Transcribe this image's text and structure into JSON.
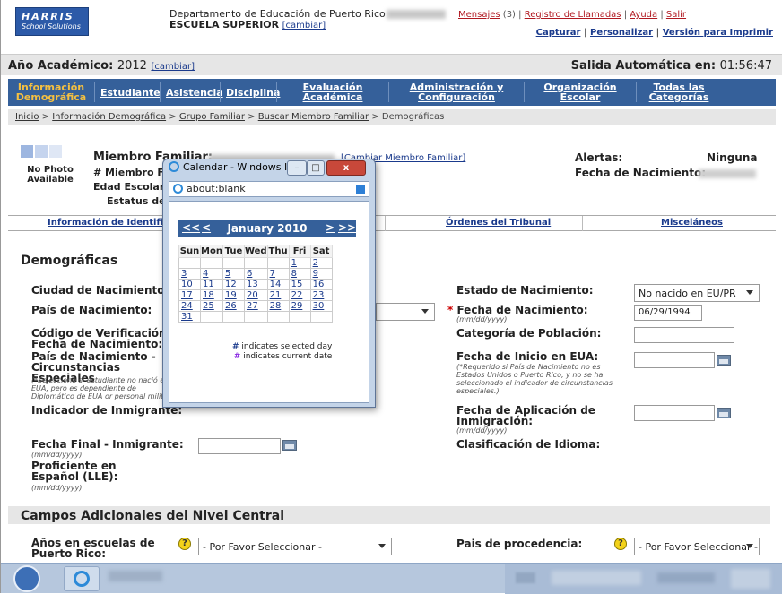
{
  "header": {
    "logo_line1": "HARRIS",
    "logo_line2": "School Solutions",
    "department": "Departamento de Educación de Puerto Rico",
    "school": "ESCUELA SUPERIOR",
    "school_change": "[cambiar]",
    "messages_label": "Mensajes",
    "messages_count": "(3)",
    "call_log": "Registro de Llamadas",
    "help": "Ayuda",
    "logout": "Salir",
    "capture": "Capturar",
    "customize": "Personalizar",
    "print_version": "Versión para Imprimir"
  },
  "yearbar": {
    "year_label": "Año Académico:",
    "year_value": "2012",
    "year_change": "[cambiar]",
    "auto_label": "Salida Automática en:",
    "auto_value": "01:56:47"
  },
  "nav": {
    "items": [
      {
        "label": "Información\nDemográfica"
      },
      {
        "label": "Estudiante"
      },
      {
        "label": "Asistencia"
      },
      {
        "label": "Disciplina"
      },
      {
        "label": "Evaluación\nAcadémica"
      },
      {
        "label": "Administración y\nConfiguración"
      },
      {
        "label": "Organización\nEscolar"
      },
      {
        "label": "Todas las\nCategorías"
      }
    ]
  },
  "breadcrumb": {
    "home": "Inicio",
    "demo": "Información Demográfica",
    "family": "Grupo Familiar",
    "search": "Buscar Miembro Familiar",
    "current": "Demográficas"
  },
  "member": {
    "photo_text": "No Photo Available",
    "family_member": "Miembro Familiar:",
    "member_number": "# Miembro Fa",
    "school_age": "Edad Escolar:",
    "status": "Estatus de Ma",
    "change_member": "[Cambiar Miembro Familiar]",
    "alerts_label": "Alertas:",
    "alerts_value": "Ninguna",
    "birth_label": "Fecha de Nacimiento:"
  },
  "tabs": {
    "identification": "Información de Identificac",
    "court_orders": "Órdenes del Tribunal",
    "misc": "Misceláneos"
  },
  "form": {
    "section_title": "Demográficas",
    "birth_city": "Ciudad de Nacimiento:",
    "birth_country": "País de Nacimiento:",
    "verification_code": "Código de Verificación de Fecha de Nacimiento:",
    "country_special": "País de Nacimiento - Circunstancias Especiales",
    "country_special_hint": "(*Seleccione si estudiante no nació e EUA, pero es dependiente de Diplomático de EUA or personal milit",
    "immigrant_indicator": "Indicador de Inmigrante:",
    "immigrant_end": "Fecha Final - Inmigrante:",
    "immigrant_end_hint": "(mm/dd/yyyy)",
    "spanish_proficient": "Proficiente en Español (LLE):",
    "spanish_hint": "(mm/dd/yyyy)",
    "birth_state": "Estado de Nacimiento:",
    "birth_state_value": "No nacido en EU/PR",
    "birth_date_req": "*",
    "birth_date": "Fecha de Nacimiento:",
    "birth_date_hint": "(mm/dd/yyyy)",
    "birth_date_value": "06/29/1994",
    "population_cat": "Categoría de Población:",
    "us_start": "Fecha de Inicio en EUA:",
    "us_start_hint": "(*Requerido si País de Nacimiento no es Estados Unidos o Puerto Rico, y no se ha seleccionado el indicador de circunstancias especiales.)",
    "immigration_apply": "Fecha de Aplicación de Inmigración:",
    "immigration_hint": "(mm/dd/yyyy)",
    "language_class": "Clasificación de Idioma:",
    "central_title": "Campos Adicionales del Nivel Central",
    "years_pr": "Años en escuelas de Puerto Rico:",
    "years_pr_value": "- Por Favor Seleccionar -",
    "origin_country": "Pais de procedencia:",
    "origin_value": "- Por Favor Seleccionar -"
  },
  "calendar": {
    "window_title": "Calendar - Windows In...",
    "address": "about:blank",
    "prev_year": "<<",
    "prev_month": "<",
    "month": "January 2010",
    "next_month": ">",
    "next_year": ">>",
    "weekdays": [
      "Sun",
      "Mon",
      "Tue",
      "Wed",
      "Thu",
      "Fri",
      "Sat"
    ],
    "weeks": [
      [
        "",
        "",
        "",
        "",
        "",
        "1",
        "2"
      ],
      [
        "3",
        "4",
        "5",
        "6",
        "7",
        "8",
        "9"
      ],
      [
        "10",
        "11",
        "12",
        "13",
        "14",
        "15",
        "16"
      ],
      [
        "17",
        "18",
        "19",
        "20",
        "21",
        "22",
        "23"
      ],
      [
        "24",
        "25",
        "26",
        "27",
        "28",
        "29",
        "30"
      ],
      [
        "31",
        "",
        "",
        "",
        "",
        "",
        ""
      ]
    ],
    "legend1_mark": "#",
    "legend1": "indicates selected day",
    "legend2_mark": "#",
    "legend2": "indicates current date"
  }
}
